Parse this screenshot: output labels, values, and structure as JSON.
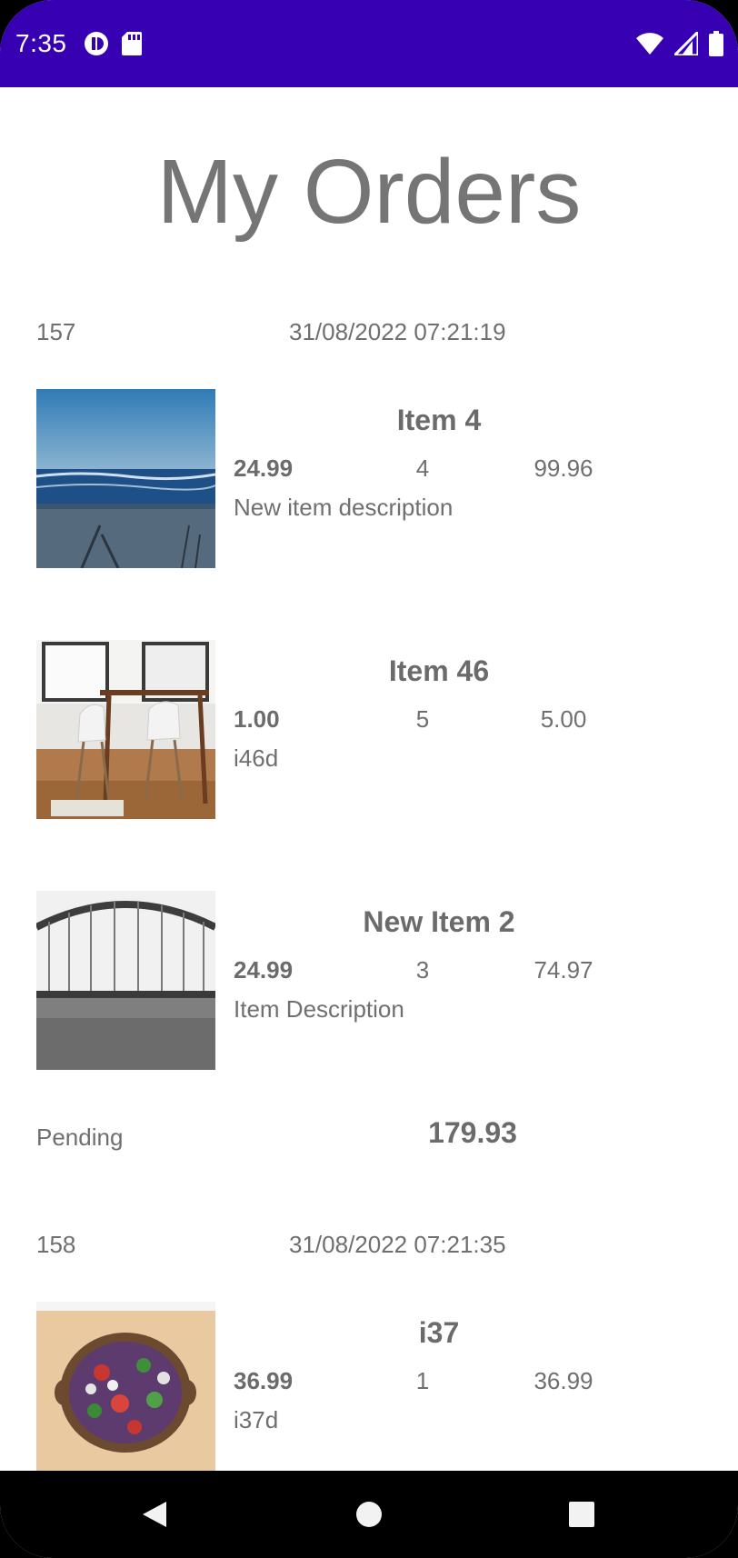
{
  "status_bar": {
    "time": "7:35",
    "left_icons": [
      "sync-icon",
      "sd-card-icon"
    ],
    "right_icons": [
      "wifi-icon",
      "signal-icon",
      "battery-icon"
    ]
  },
  "page": {
    "title": "My Orders"
  },
  "orders": [
    {
      "id": "157",
      "date": "31/08/2022 07:21:19",
      "items": [
        {
          "name": "Item 4",
          "price": "24.99",
          "qty": "4",
          "total": "99.96",
          "description": "New item description",
          "image": "beach-photo"
        },
        {
          "name": "Item 46",
          "price": "1.00",
          "qty": "5",
          "total": "5.00",
          "description": "i46d",
          "image": "dining-chairs-photo"
        },
        {
          "name": "New Item 2",
          "price": "24.99",
          "qty": "3",
          "total": "74.97",
          "description": "Item Description",
          "image": "bridge-photo"
        }
      ],
      "status": "Pending",
      "sum": "179.93"
    },
    {
      "id": "158",
      "date": "31/08/2022 07:21:35",
      "items": [
        {
          "name": "i37",
          "price": "36.99",
          "qty": "1",
          "total": "36.99",
          "description": "i37d",
          "image": "salad-bowl-photo"
        }
      ]
    }
  ],
  "nav_bar": {
    "buttons": [
      "back-icon",
      "home-icon",
      "recents-icon"
    ]
  },
  "colors": {
    "status_bar": "#3700b3",
    "text": "#707070",
    "nav_bar": "#000000"
  }
}
